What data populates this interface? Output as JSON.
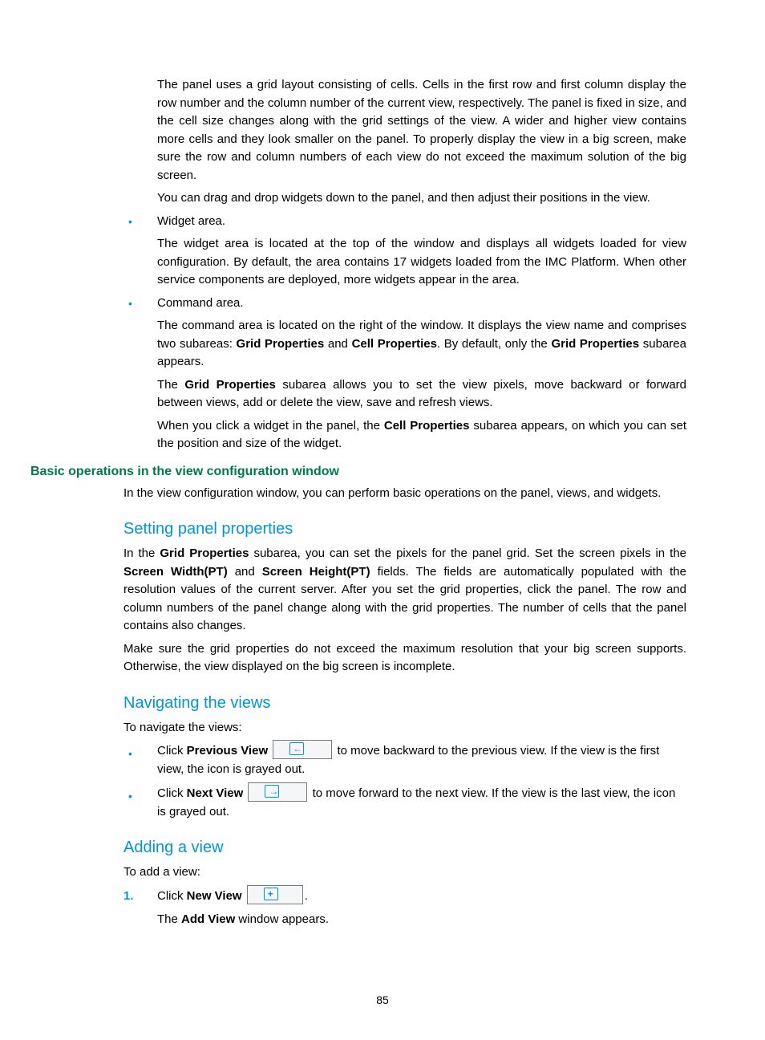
{
  "pageNumber": "85",
  "paras": {
    "p1": "The panel uses a grid layout consisting of cells. Cells in the first row and first column display the row number and the column number of the current view, respectively. The panel is fixed in size, and the cell size changes along with the grid settings of the view. A wider and higher view contains more cells and they look smaller on the panel. To properly display the view in a big screen, make sure the row and column numbers of each view do not exceed the maximum solution of the big screen.",
    "p2": "You can drag and drop widgets down to the panel, and then adjust their positions in the view.",
    "li1_head": "Widget area.",
    "li1_body": "The widget area is located at the top of the window and displays all widgets loaded for view configuration. By default, the area contains 17 widgets loaded from the IMC Platform. When other service components are deployed, more widgets appear in the area.",
    "li2_head": "Command area.",
    "li2_body_a": "The command area is located on the right of the window. It displays the view name and comprises two subareas: ",
    "li2_body_b": " and ",
    "li2_body_c": ". By default, only the ",
    "li2_body_d": " subarea appears.",
    "li2_p2_a": "The ",
    "li2_p2_b": " subarea allows you to set the view pixels, move backward or forward between views, add or delete the view, save and refresh views.",
    "li2_p3_a": "When you click a widget in the panel, the ",
    "li2_p3_b": " subarea appears, on which you can set the position and size of the widget.",
    "h_basic": "Basic operations in the view configuration window",
    "p3": "In the view configuration window, you can perform basic operations on the panel, views, and widgets.",
    "h_setting": "Setting panel properties",
    "p4_a": "In the ",
    "p4_b": " subarea, you can set the pixels for the panel grid. Set the screen pixels in the ",
    "p4_c": " and ",
    "p4_d": " fields. The fields are automatically populated with the resolution values of the current server. After you set the grid properties, click the panel. The row and column numbers of the panel change along with the grid properties. The number of cells that the panel contains also changes.",
    "p5": "Make sure the grid properties do not exceed the maximum resolution that your big screen supports. Otherwise, the view displayed on the big screen is incomplete.",
    "h_nav": "Navigating the views",
    "p6": "To navigate the views:",
    "nav1_a": "Click ",
    "nav1_b": " to move backward to the previous view. If the view is the first view, the icon is grayed out.",
    "nav2_a": "Click ",
    "nav2_b": " to move forward to the next view. If the view is the last view, the icon is grayed out.",
    "h_add": "Adding a view",
    "p7": "To add a view:",
    "step1_a": "Click ",
    "step1_b": ".",
    "step1_p2_a": "The ",
    "step1_p2_b": " window appears."
  },
  "bold": {
    "grid_props": "Grid Properties",
    "cell_props": "Cell Properties",
    "screen_w": "Screen Width(PT)",
    "screen_h": "Screen Height(PT)",
    "prev_view": "Previous View",
    "next_view": "Next View",
    "new_view": "New View",
    "add_view": "Add View",
    "num1": "1."
  }
}
